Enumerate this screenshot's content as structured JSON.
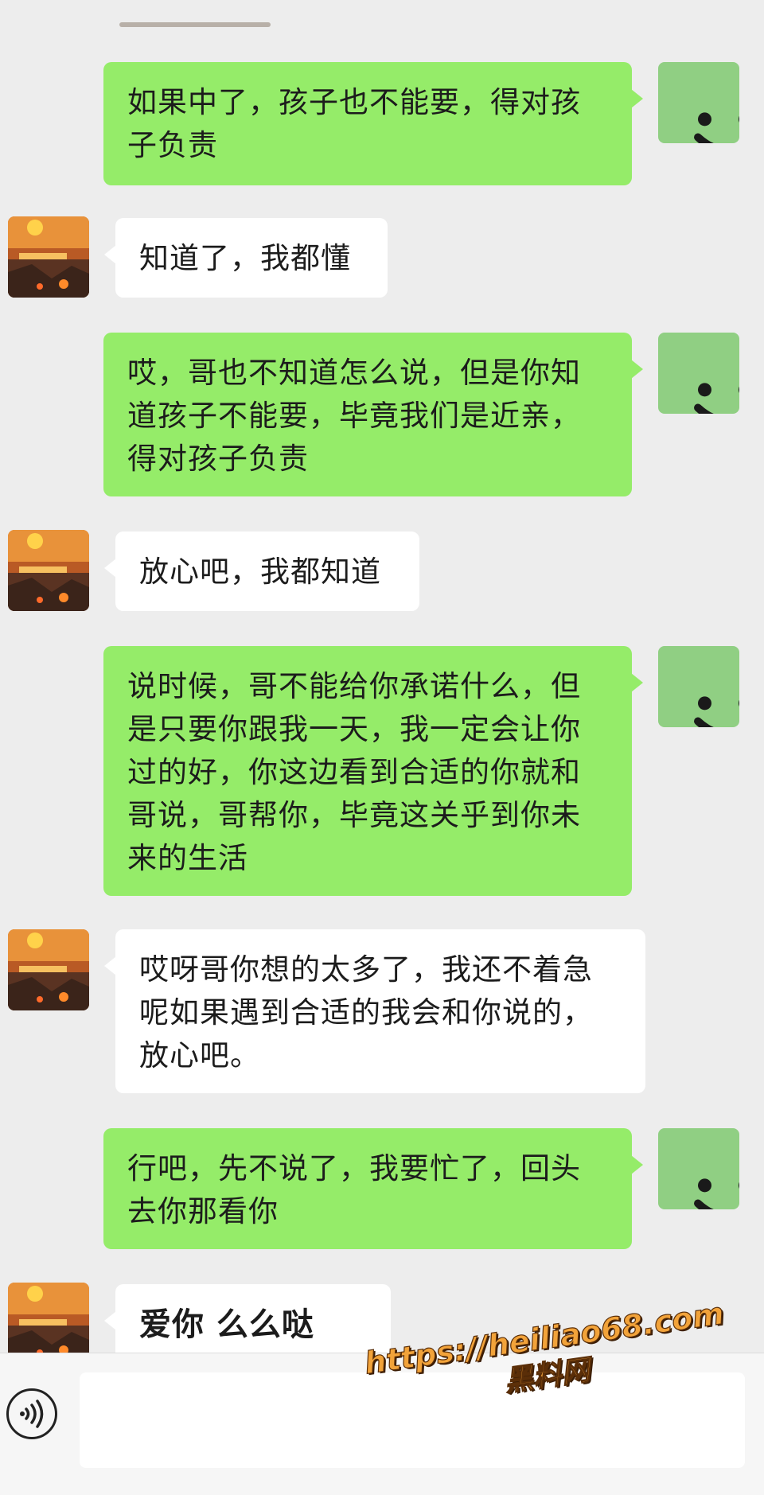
{
  "messages": [
    {
      "side": "out",
      "text": "如果中了，孩子也不能要，得对孩子负责",
      "lines": [
        "如果中了，孩子也不能要，得对孩",
        "子负责"
      ]
    },
    {
      "side": "in",
      "text": "知道了，我都懂",
      "lines": [
        "知道了，我都懂"
      ]
    },
    {
      "side": "out",
      "text": "哎，哥也不知道怎么说，但是你知道孩子不能要，毕竟我们是近亲，得对孩子负责",
      "lines": [
        "哎，哥也不知道怎么说，但是你知",
        "道孩子不能要，毕竟我们是近亲，",
        "得对孩子负责"
      ]
    },
    {
      "side": "in",
      "text": "放心吧，我都知道",
      "lines": [
        "放心吧，我都知道"
      ]
    },
    {
      "side": "out",
      "text": "说时候，哥不能给你承诺什么，但是只要你跟我一天，我一定会让你过的好，你这边看到合适的你就和哥说，哥帮你，毕竟这关乎到你未来的生活",
      "lines": [
        "说时候，哥不能给你承诺什么，但",
        "是只要你跟我一天，我一定会让你",
        "过的好，你这边看到合适的你就和",
        "哥说，哥帮你，毕竟这关乎到你未",
        "来的生活"
      ]
    },
    {
      "side": "in",
      "text": "哎呀哥你想的太多了，我还不着急呢如果遇到合适的我会和你说的，放心吧。",
      "lines": [
        "哎呀哥你想的太多了，我还不着急",
        "呢如果遇到合适的我会和你说的，",
        "放心吧。"
      ]
    },
    {
      "side": "out",
      "text": "行吧，先不说了，我要忙了，回头去你那看你",
      "lines": [
        "行吧，先不说了，我要忙了，回头",
        "去你那看你"
      ]
    },
    {
      "side": "in",
      "text": "爱你 么么哒",
      "lines": [
        "爱你 么么哒"
      ]
    }
  ],
  "watermark": {
    "url": "https://heiliao68.com",
    "site": "黑料网"
  },
  "icons": {
    "self_avatar": "smile-face-icon",
    "contact_avatar": "sunset-photo-avatar",
    "voice": "voice-input-icon"
  },
  "colors": {
    "background": "#ededed",
    "outgoing_bubble": "#95ec69",
    "incoming_bubble": "#ffffff",
    "self_avatar_bg": "#90cf83",
    "watermark_text": "#f2a33a"
  }
}
